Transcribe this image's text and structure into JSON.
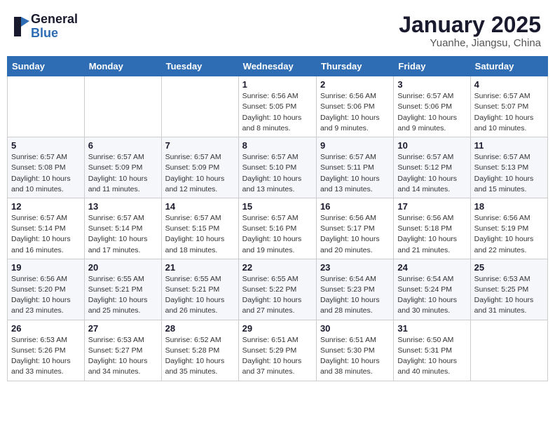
{
  "header": {
    "logo_general": "General",
    "logo_blue": "Blue",
    "title": "January 2025",
    "subtitle": "Yuanhe, Jiangsu, China"
  },
  "weekdays": [
    "Sunday",
    "Monday",
    "Tuesday",
    "Wednesday",
    "Thursday",
    "Friday",
    "Saturday"
  ],
  "weeks": [
    [
      {
        "day": "",
        "info": ""
      },
      {
        "day": "",
        "info": ""
      },
      {
        "day": "",
        "info": ""
      },
      {
        "day": "1",
        "info": "Sunrise: 6:56 AM\nSunset: 5:05 PM\nDaylight: 10 hours and 8 minutes."
      },
      {
        "day": "2",
        "info": "Sunrise: 6:56 AM\nSunset: 5:06 PM\nDaylight: 10 hours and 9 minutes."
      },
      {
        "day": "3",
        "info": "Sunrise: 6:57 AM\nSunset: 5:06 PM\nDaylight: 10 hours and 9 minutes."
      },
      {
        "day": "4",
        "info": "Sunrise: 6:57 AM\nSunset: 5:07 PM\nDaylight: 10 hours and 10 minutes."
      }
    ],
    [
      {
        "day": "5",
        "info": "Sunrise: 6:57 AM\nSunset: 5:08 PM\nDaylight: 10 hours and 10 minutes."
      },
      {
        "day": "6",
        "info": "Sunrise: 6:57 AM\nSunset: 5:09 PM\nDaylight: 10 hours and 11 minutes."
      },
      {
        "day": "7",
        "info": "Sunrise: 6:57 AM\nSunset: 5:09 PM\nDaylight: 10 hours and 12 minutes."
      },
      {
        "day": "8",
        "info": "Sunrise: 6:57 AM\nSunset: 5:10 PM\nDaylight: 10 hours and 13 minutes."
      },
      {
        "day": "9",
        "info": "Sunrise: 6:57 AM\nSunset: 5:11 PM\nDaylight: 10 hours and 13 minutes."
      },
      {
        "day": "10",
        "info": "Sunrise: 6:57 AM\nSunset: 5:12 PM\nDaylight: 10 hours and 14 minutes."
      },
      {
        "day": "11",
        "info": "Sunrise: 6:57 AM\nSunset: 5:13 PM\nDaylight: 10 hours and 15 minutes."
      }
    ],
    [
      {
        "day": "12",
        "info": "Sunrise: 6:57 AM\nSunset: 5:14 PM\nDaylight: 10 hours and 16 minutes."
      },
      {
        "day": "13",
        "info": "Sunrise: 6:57 AM\nSunset: 5:14 PM\nDaylight: 10 hours and 17 minutes."
      },
      {
        "day": "14",
        "info": "Sunrise: 6:57 AM\nSunset: 5:15 PM\nDaylight: 10 hours and 18 minutes."
      },
      {
        "day": "15",
        "info": "Sunrise: 6:57 AM\nSunset: 5:16 PM\nDaylight: 10 hours and 19 minutes."
      },
      {
        "day": "16",
        "info": "Sunrise: 6:56 AM\nSunset: 5:17 PM\nDaylight: 10 hours and 20 minutes."
      },
      {
        "day": "17",
        "info": "Sunrise: 6:56 AM\nSunset: 5:18 PM\nDaylight: 10 hours and 21 minutes."
      },
      {
        "day": "18",
        "info": "Sunrise: 6:56 AM\nSunset: 5:19 PM\nDaylight: 10 hours and 22 minutes."
      }
    ],
    [
      {
        "day": "19",
        "info": "Sunrise: 6:56 AM\nSunset: 5:20 PM\nDaylight: 10 hours and 23 minutes."
      },
      {
        "day": "20",
        "info": "Sunrise: 6:55 AM\nSunset: 5:21 PM\nDaylight: 10 hours and 25 minutes."
      },
      {
        "day": "21",
        "info": "Sunrise: 6:55 AM\nSunset: 5:21 PM\nDaylight: 10 hours and 26 minutes."
      },
      {
        "day": "22",
        "info": "Sunrise: 6:55 AM\nSunset: 5:22 PM\nDaylight: 10 hours and 27 minutes."
      },
      {
        "day": "23",
        "info": "Sunrise: 6:54 AM\nSunset: 5:23 PM\nDaylight: 10 hours and 28 minutes."
      },
      {
        "day": "24",
        "info": "Sunrise: 6:54 AM\nSunset: 5:24 PM\nDaylight: 10 hours and 30 minutes."
      },
      {
        "day": "25",
        "info": "Sunrise: 6:53 AM\nSunset: 5:25 PM\nDaylight: 10 hours and 31 minutes."
      }
    ],
    [
      {
        "day": "26",
        "info": "Sunrise: 6:53 AM\nSunset: 5:26 PM\nDaylight: 10 hours and 33 minutes."
      },
      {
        "day": "27",
        "info": "Sunrise: 6:53 AM\nSunset: 5:27 PM\nDaylight: 10 hours and 34 minutes."
      },
      {
        "day": "28",
        "info": "Sunrise: 6:52 AM\nSunset: 5:28 PM\nDaylight: 10 hours and 35 minutes."
      },
      {
        "day": "29",
        "info": "Sunrise: 6:51 AM\nSunset: 5:29 PM\nDaylight: 10 hours and 37 minutes."
      },
      {
        "day": "30",
        "info": "Sunrise: 6:51 AM\nSunset: 5:30 PM\nDaylight: 10 hours and 38 minutes."
      },
      {
        "day": "31",
        "info": "Sunrise: 6:50 AM\nSunset: 5:31 PM\nDaylight: 10 hours and 40 minutes."
      },
      {
        "day": "",
        "info": ""
      }
    ]
  ]
}
